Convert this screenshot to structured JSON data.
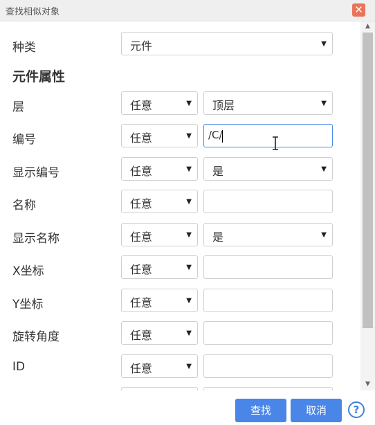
{
  "dialog": {
    "title": "查找相似对象",
    "close_icon": "close-icon",
    "close_color": "#e8745a"
  },
  "kind": {
    "label": "种类",
    "value": "元件"
  },
  "section_title": "元件属性",
  "rows": [
    {
      "label": "层",
      "match": "任意",
      "value": "顶层",
      "type": "select"
    },
    {
      "label": "编号",
      "match": "任意",
      "value": "/C/",
      "type": "input"
    },
    {
      "label": "显示编号",
      "match": "任意",
      "value": "是",
      "type": "select"
    },
    {
      "label": "名称",
      "match": "任意",
      "value": "",
      "type": "input"
    },
    {
      "label": "显示名称",
      "match": "任意",
      "value": "是",
      "type": "select"
    },
    {
      "label": "X坐标",
      "match": "任意",
      "value": "",
      "type": "input"
    },
    {
      "label": "Y坐标",
      "match": "任意",
      "value": "",
      "type": "input"
    },
    {
      "label": "旋转角度",
      "match": "任意",
      "value": "",
      "type": "input"
    },
    {
      "label": "ID",
      "match": "任意",
      "value": "",
      "type": "input"
    }
  ],
  "footer": {
    "find_label": "查找",
    "cancel_label": "取消",
    "help_glyph": "?",
    "accent": "#4a86e8"
  }
}
